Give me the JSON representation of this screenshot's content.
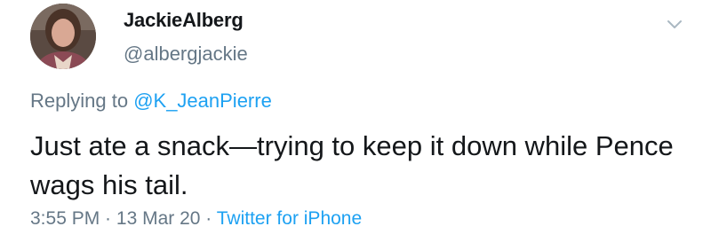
{
  "author": {
    "display_name": "JackieAlberg",
    "handle": "@albergjackie",
    "avatar_icon": "profile-photo"
  },
  "reply": {
    "prefix": "Replying to ",
    "mention": "@K_JeanPierre"
  },
  "tweet": {
    "text": "Just ate a snack—trying to keep it down while Pence wags his tail."
  },
  "meta": {
    "time": "3:55 PM",
    "separator_1": " · ",
    "date": "13 Mar 20",
    "separator_2": " · ",
    "source": "Twitter for iPhone"
  },
  "colors": {
    "text_primary": "#14171a",
    "text_secondary": "#657786",
    "link": "#1da1f2"
  },
  "icons": {
    "menu": "chevron-down-icon"
  }
}
